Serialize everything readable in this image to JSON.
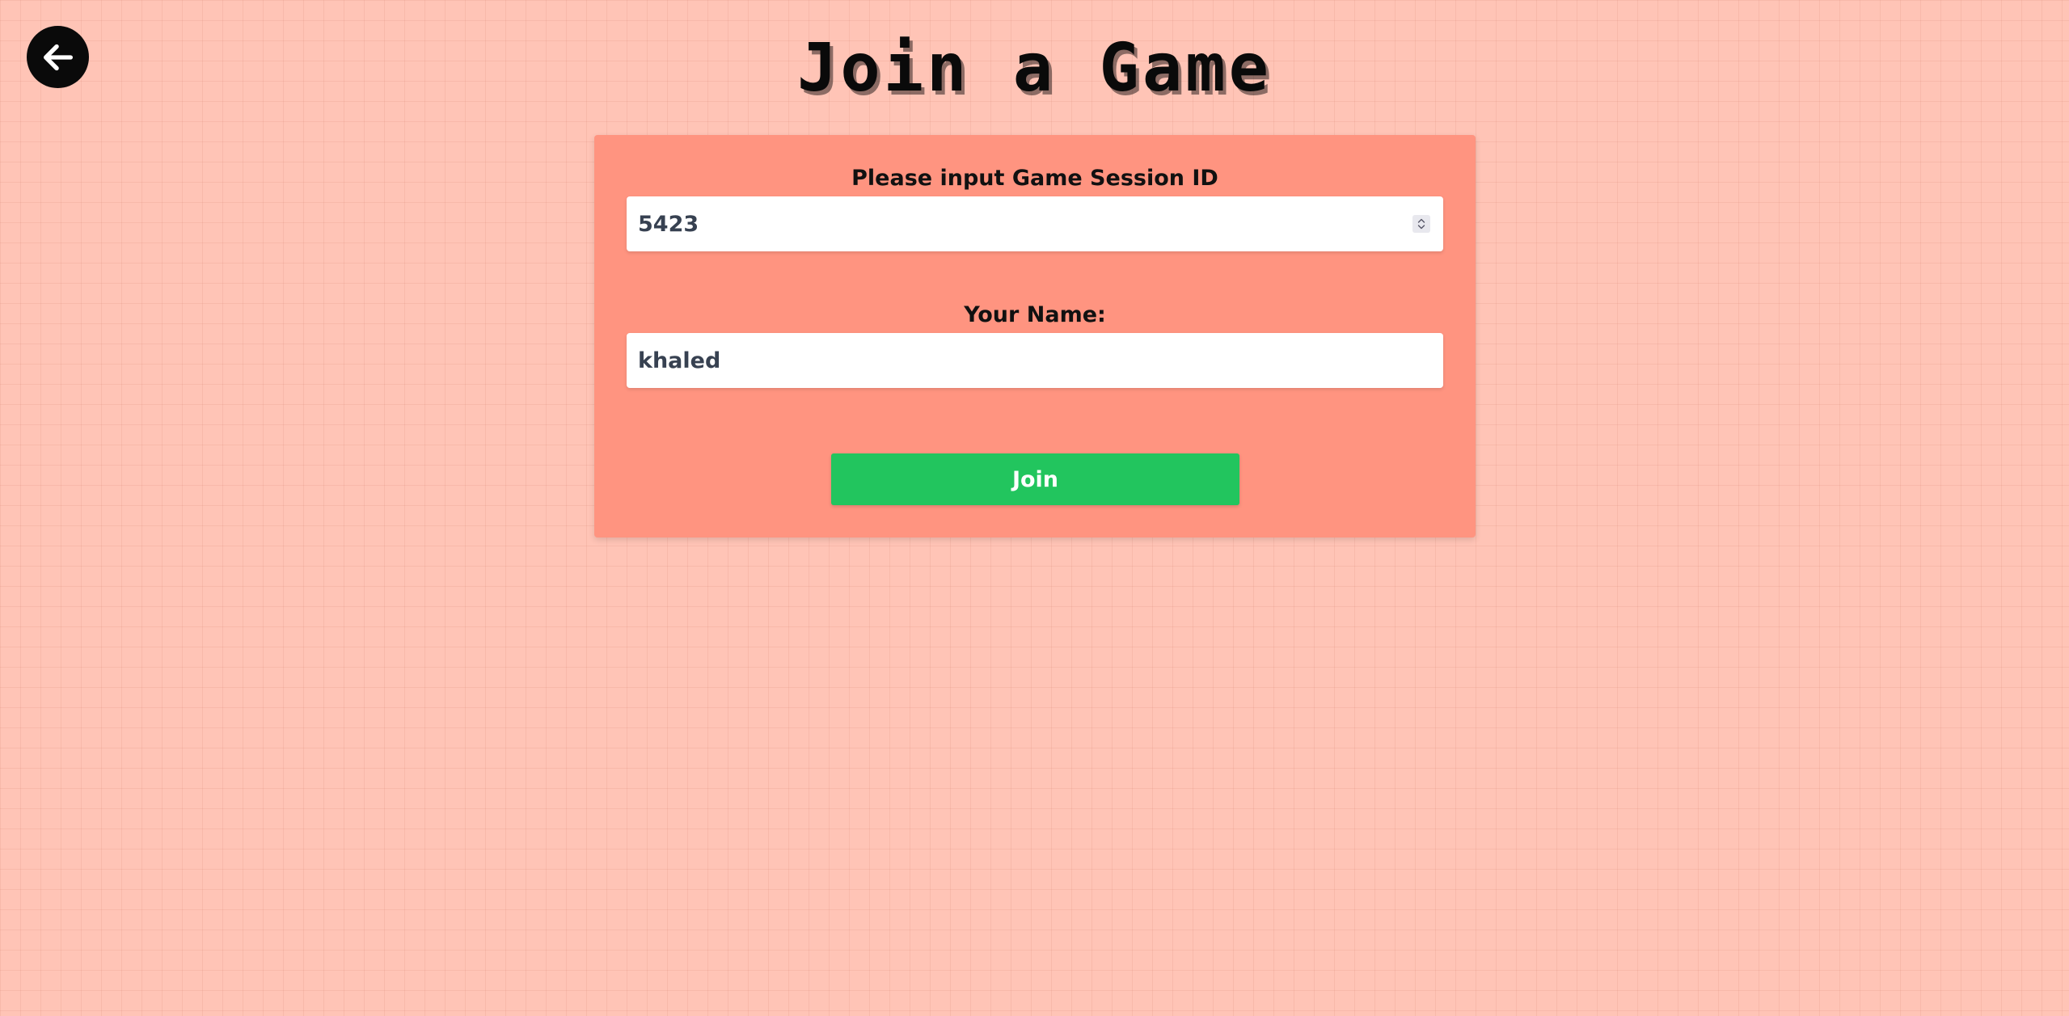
{
  "header": {
    "back_icon": "arrow-left-icon",
    "title": "Join a Game"
  },
  "form": {
    "session": {
      "label": "Please input Game Session ID",
      "value": "5423",
      "spinner_icon": "stepper-arrows-icon"
    },
    "name": {
      "label": "Your Name:",
      "value": "khaled"
    },
    "join_label": "Join"
  },
  "colors": {
    "background": "#ffc4b6",
    "card": "#ff9480",
    "join_button": "#22c55e",
    "back_button": "#0a0a0a"
  }
}
